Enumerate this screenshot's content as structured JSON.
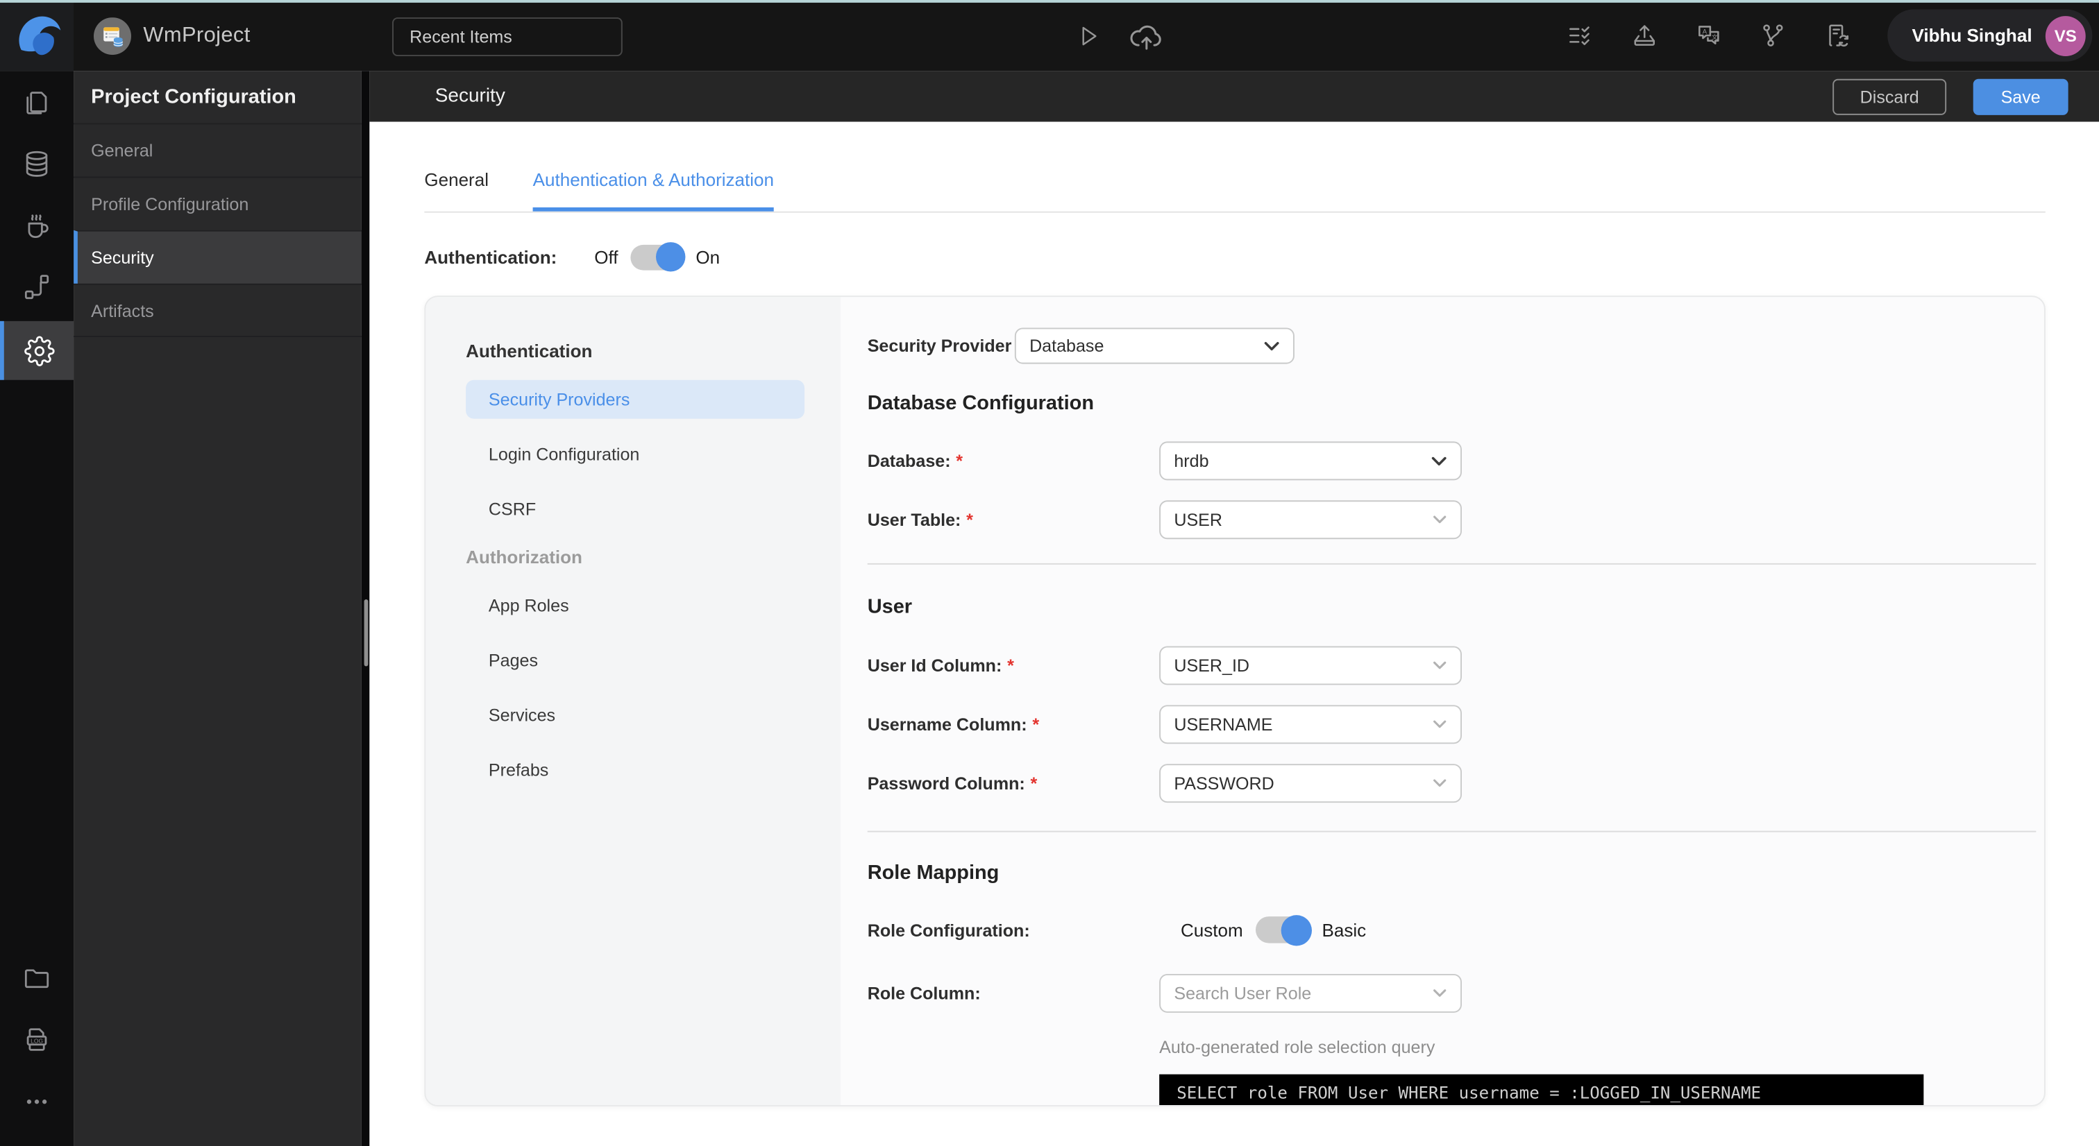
{
  "topbar": {
    "project_name": "WmProject",
    "recent_items_label": "Recent Items",
    "user_name": "Vibhu Singhal",
    "user_initials": "VS",
    "action_icons": [
      "task-list-icon",
      "export-icon",
      "translate-icon",
      "branch-icon",
      "file-sync-icon"
    ]
  },
  "icons": {
    "log_label": "LOG",
    "translate_a": "A",
    "translate_b": "文"
  },
  "rail": {
    "icons": [
      "pages-icon",
      "database-icon",
      "java-service-icon",
      "api-icon",
      "settings-icon",
      "folder-icon",
      "logs-icon",
      "more-icon"
    ],
    "active": "settings-icon"
  },
  "project_config": {
    "title": "Project Configuration",
    "items": [
      "General",
      "Profile Configuration",
      "Security",
      "Artifacts"
    ],
    "active_index": 2
  },
  "subheader": {
    "title": "Security",
    "discard_label": "Discard",
    "save_label": "Save"
  },
  "tabs": {
    "items": [
      "General",
      "Authentication & Authorization"
    ],
    "active_index": 1
  },
  "authentication_toggle": {
    "label": "Authentication:",
    "off_label": "Off",
    "on_label": "On",
    "state": "on"
  },
  "security_nav": {
    "auth_heading": "Authentication",
    "auth_items": [
      "Security Providers",
      "Login Configuration",
      "CSRF"
    ],
    "active_item": "Security Providers",
    "authz_heading": "Authorization",
    "authz_items": [
      "App Roles",
      "Pages",
      "Services",
      "Prefabs"
    ]
  },
  "form": {
    "required_marker": "*",
    "security_provider_label": "Security Provider",
    "security_provider_value": "Database",
    "db_heading": "Database Configuration",
    "database_label": "Database:",
    "database_value": "hrdb",
    "user_table_label": "User Table:",
    "user_table_value": "USER",
    "user_heading": "User",
    "user_id_label": "User Id Column:",
    "user_id_value": "USER_ID",
    "username_label": "Username Column:",
    "username_value": "USERNAME",
    "password_label": "Password Column:",
    "password_value": "PASSWORD",
    "role_heading": "Role Mapping",
    "role_config_label": "Role Configuration:",
    "role_custom_label": "Custom",
    "role_basic_label": "Basic",
    "role_toggle_state": "basic",
    "role_column_label": "Role Column:",
    "role_column_placeholder": "Search User Role",
    "query_caption": "Auto-generated role selection query",
    "query_sql": "SELECT role FROM User WHERE username = :LOGGED_IN_USERNAME"
  },
  "colors": {
    "accent_blue": "#4a8fe8",
    "save_blue": "#4c8fe2",
    "avatar_purple": "#b55a9e",
    "active_nav_pill_bg": "#dbe8f8",
    "code_bg": "#000000"
  }
}
